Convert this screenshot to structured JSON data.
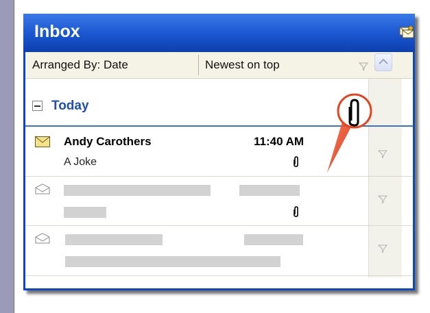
{
  "window": {
    "title": "Inbox",
    "title_icon": "envelopes-icon"
  },
  "arrange": {
    "arranged_by": "Arranged By: Date",
    "sort_order": "Newest on top"
  },
  "group": {
    "label": "Today",
    "state": "expanded"
  },
  "messages": [
    {
      "sender": "Andy Carothers",
      "time": "11:40 AM",
      "subject": "A Joke",
      "has_attachment": true,
      "read": false,
      "icon": "envelope-unread-icon"
    },
    {
      "sender": "",
      "time": "",
      "subject": "",
      "has_attachment": true,
      "read": true,
      "icon": "envelope-read-icon"
    },
    {
      "sender": "",
      "time": "",
      "subject": "",
      "has_attachment": false,
      "read": true,
      "icon": "envelope-read-icon"
    }
  ],
  "callout": {
    "icon": "paperclip-icon",
    "accent": "#e8421c"
  },
  "colors": {
    "title_bar": "#1a56cf",
    "group_label": "#1f4fb5",
    "desktop": "#9b9ab8"
  }
}
